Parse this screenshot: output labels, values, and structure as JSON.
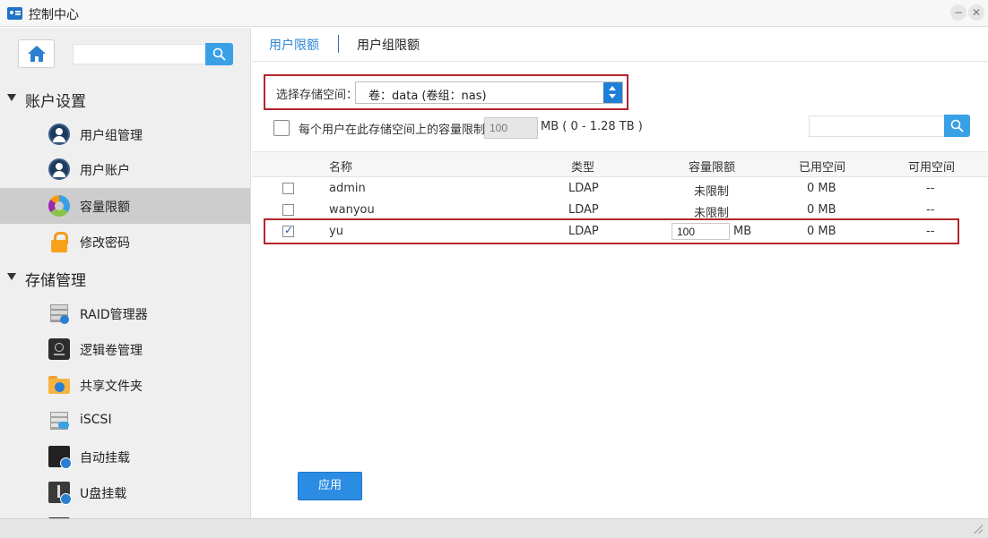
{
  "window": {
    "title": "控制中心",
    "minimize": "−",
    "close": "✕"
  },
  "sidebar": {
    "search_placeholder": "",
    "sections": [
      {
        "label": "账户设置",
        "items": [
          {
            "label": "用户组管理",
            "icon": "user-group-icon"
          },
          {
            "label": "用户账户",
            "icon": "user-account-icon"
          },
          {
            "label": "容量限额",
            "icon": "pie-chart-icon",
            "active": true
          },
          {
            "label": "修改密码",
            "icon": "lock-icon"
          }
        ]
      },
      {
        "label": "存储管理",
        "items": [
          {
            "label": "RAID管理器",
            "icon": "raid-icon"
          },
          {
            "label": "逻辑卷管理",
            "icon": "lvm-icon"
          },
          {
            "label": "共享文件夹",
            "icon": "shared-folder-icon"
          },
          {
            "label": "iSCSI",
            "icon": "iscsi-icon"
          },
          {
            "label": "自动挂载",
            "icon": "auto-mount-icon"
          },
          {
            "label": "U盘挂载",
            "icon": "usb-icon"
          }
        ]
      }
    ]
  },
  "tabs": [
    {
      "label": "用户限额",
      "active": true
    },
    {
      "label": "用户组限额",
      "active": false
    }
  ],
  "storage": {
    "label": "选择存储空间：",
    "value": "卷：data (卷组：nas)"
  },
  "limit": {
    "checked": false,
    "text": "每个用户在此存储空间上的容量限制为",
    "value": "100",
    "unit": "MB ( 0 - 1.28 TB )"
  },
  "table": {
    "columns": [
      "名称",
      "类型",
      "容量限额",
      "已用空间",
      "可用空间"
    ],
    "rows": [
      {
        "checked": false,
        "name": "admin",
        "type": "LDAP",
        "quota": "未限制",
        "used": "0 MB",
        "available": "--"
      },
      {
        "checked": false,
        "name": "wanyou",
        "type": "LDAP",
        "quota": "未限制",
        "used": "0 MB",
        "available": "--"
      },
      {
        "checked": true,
        "name": "yu",
        "type": "LDAP",
        "quota": "100",
        "quota_unit": "MB",
        "used": "0 MB",
        "available": "--"
      }
    ]
  },
  "apply_label": "应用",
  "colors": {
    "accent": "#2b8ce3",
    "highlight_border": "#b3262b",
    "tab_active": "#2b86d6"
  }
}
